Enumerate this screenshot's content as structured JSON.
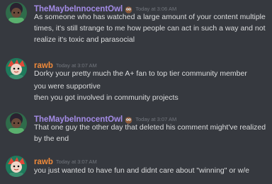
{
  "messages": [
    {
      "author": "TheMaybeInnocentOwl",
      "timestamp": "Today at 3:06 AM",
      "lines": [
        "As someone who has watched a large amount of your content multiple",
        "times, it's still strange to me how people can act in such a way and not",
        "realize it's toxic and parasocial"
      ]
    },
    {
      "author": "rawb",
      "timestamp": "Today at 3:07 AM",
      "lines": [
        "Dorky your pretty much the A+ fan to top tier community member",
        "you were supportive",
        "then you got involved in community projects"
      ]
    },
    {
      "author": "TheMaybeInnocentOwl",
      "timestamp": "Today at 3:07 AM",
      "lines": [
        "That one guy the other day that deleted his comment might've realized",
        "by the end"
      ]
    },
    {
      "author": "rawb",
      "timestamp": "Today at 3:07 AM",
      "lines": [
        "you just wanted to have fun and didnt care about \"winning\" or w/e"
      ]
    }
  ],
  "colors": {
    "background": "#36393f",
    "text": "#dcddde",
    "timestamp": "#72767d",
    "owl_name": "#a48ce6",
    "rawb_name": "#f08a3a"
  },
  "icons": {
    "owl_badge": "owl-emoji-icon"
  }
}
